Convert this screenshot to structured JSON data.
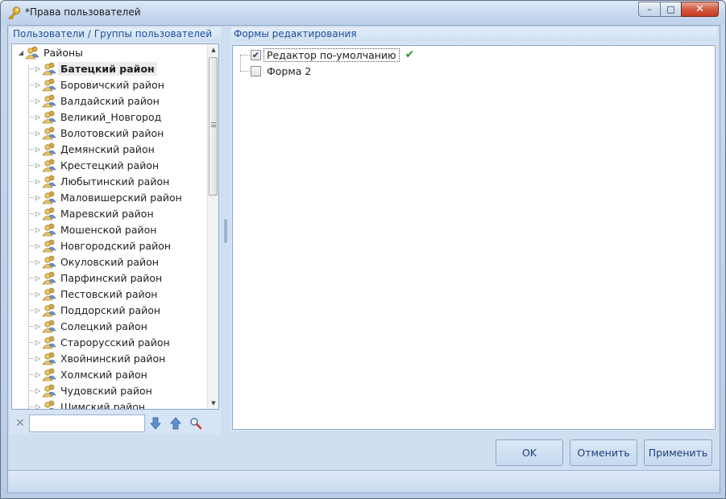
{
  "window": {
    "title": "*Права пользователей",
    "icon": "key-icon",
    "controls": {
      "minimize": "–",
      "maximize": "□",
      "close": "✕"
    }
  },
  "left_panel": {
    "header": "Пользователи / Группы пользователей",
    "tree": {
      "root": {
        "label": "Районы",
        "icon": "user-group-icon",
        "expander": "◢"
      },
      "items": [
        {
          "label": "Батецкий район",
          "selected": true
        },
        {
          "label": "Боровичский район"
        },
        {
          "label": "Валдайский район"
        },
        {
          "label": "Великий_Новгород"
        },
        {
          "label": "Волотовский район"
        },
        {
          "label": "Демянский район"
        },
        {
          "label": "Крестецкий район"
        },
        {
          "label": "Любытинский район"
        },
        {
          "label": "Маловишерский район"
        },
        {
          "label": "Маревский район"
        },
        {
          "label": "Мошенской район"
        },
        {
          "label": "Новгородский район"
        },
        {
          "label": "Окуловский район"
        },
        {
          "label": "Парфинский район"
        },
        {
          "label": "Пестовский район"
        },
        {
          "label": "Поддорский район"
        },
        {
          "label": "Солецкий район"
        },
        {
          "label": "Старорусский район"
        },
        {
          "label": "Хвойнинский район"
        },
        {
          "label": "Холмский район"
        },
        {
          "label": "Чудовский район"
        },
        {
          "label": "Шимский район"
        }
      ],
      "item_expander": "▷"
    },
    "search": {
      "clear": "✕",
      "value": "",
      "placeholder": ""
    }
  },
  "right_panel": {
    "header": "Формы редактирования",
    "forms": [
      {
        "label": "Редактор по-умолчанию",
        "checked": true,
        "default_mark": "✔"
      },
      {
        "label": "Форма 2",
        "checked": false
      }
    ]
  },
  "buttons": {
    "ok": "OK",
    "cancel": "Отменить",
    "apply": "Применить"
  },
  "colors": {
    "header_text": "#1c4f9a",
    "button_text": "#1c3f78",
    "panel_bg": "#d6e4f5",
    "check_green": "#2d9a2d"
  }
}
